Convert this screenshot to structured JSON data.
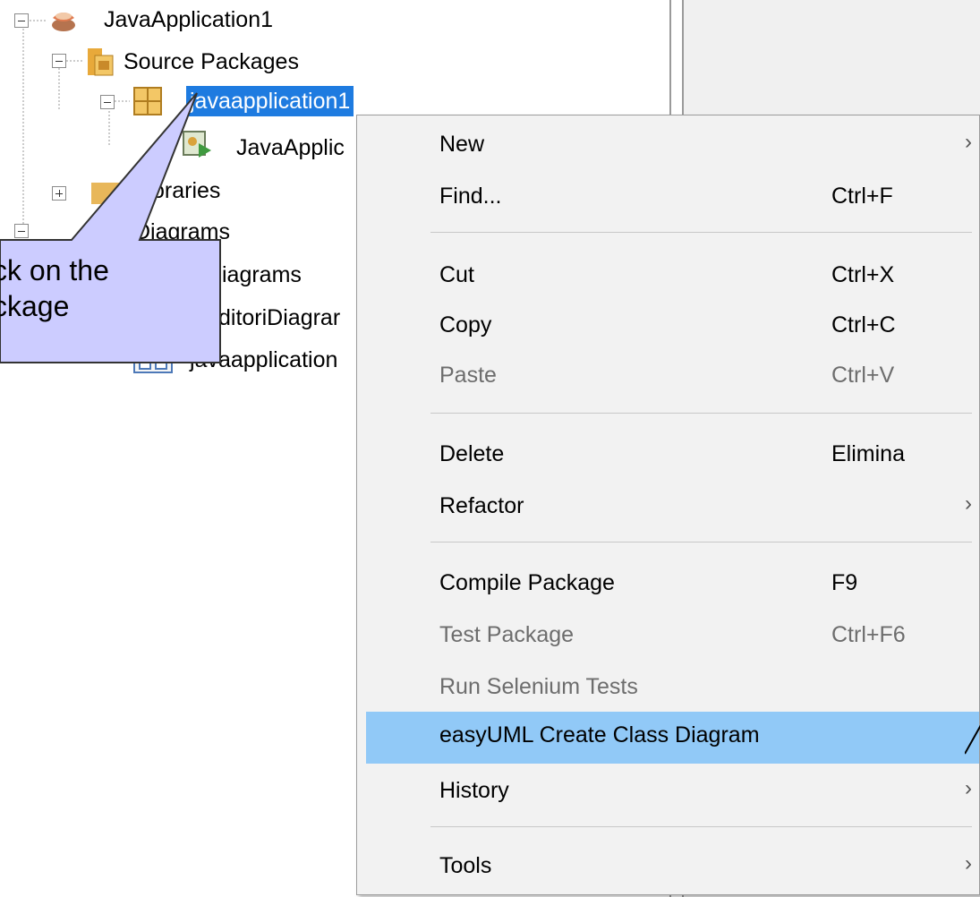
{
  "tree": {
    "project": "JavaApplication1",
    "source_packages": "Source Packages",
    "package": "javaapplication1",
    "java_file": "JavaApplic",
    "libraries": "oraries",
    "diagrams": "Diagrams",
    "diagrams_child1": "iagrams",
    "diagrams_child2": "ditoriDiagrar",
    "diagrams_child3": "javaapplication"
  },
  "callout": {
    "line1": "ck on the",
    "line2": "ckage"
  },
  "menu": {
    "items": [
      {
        "label": "New",
        "shortcut": "",
        "submenu": true,
        "disabled": false
      },
      {
        "label": "Find...",
        "shortcut": "Ctrl+F",
        "submenu": false,
        "disabled": false
      },
      {
        "label": "Cut",
        "shortcut": "Ctrl+X",
        "submenu": false,
        "disabled": false
      },
      {
        "label": "Copy",
        "shortcut": "Ctrl+C",
        "submenu": false,
        "disabled": false
      },
      {
        "label": "Paste",
        "shortcut": "Ctrl+V",
        "submenu": false,
        "disabled": true
      },
      {
        "label": "Delete",
        "shortcut": "Elimina",
        "submenu": false,
        "disabled": false
      },
      {
        "label": "Refactor",
        "shortcut": "",
        "submenu": true,
        "disabled": false
      },
      {
        "label": "Compile Package",
        "shortcut": "F9",
        "submenu": false,
        "disabled": false
      },
      {
        "label": "Test Package",
        "shortcut": "Ctrl+F6",
        "submenu": false,
        "disabled": true
      },
      {
        "label": "Run Selenium Tests",
        "shortcut": "",
        "submenu": false,
        "disabled": true
      },
      {
        "label": "easyUML Create Class Diagram",
        "shortcut": "",
        "submenu": false,
        "disabled": false,
        "highlighted": true
      },
      {
        "label": "History",
        "shortcut": "",
        "submenu": true,
        "disabled": false
      },
      {
        "label": "Tools",
        "shortcut": "",
        "submenu": true,
        "disabled": false
      }
    ],
    "submenu_arrow": "›"
  },
  "colors": {
    "selection": "#1e7be0",
    "menu_highlight": "#91c9f7",
    "callout_fill": "#ccccff"
  }
}
